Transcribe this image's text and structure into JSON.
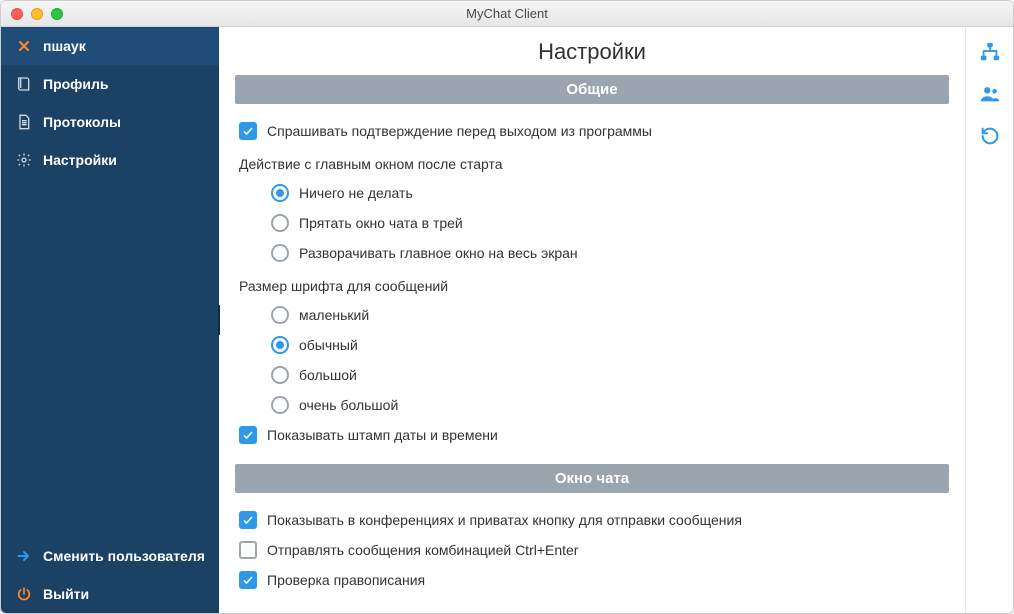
{
  "window": {
    "title": "MyChat Client"
  },
  "sidebar": {
    "items": [
      {
        "label": "пшаук"
      },
      {
        "label": "Профиль"
      },
      {
        "label": "Протоколы"
      },
      {
        "label": "Настройки"
      }
    ],
    "switch_user": "Сменить пользователя",
    "exit": "Выйти"
  },
  "content": {
    "title": "Настройки",
    "sections": [
      {
        "header": "Общие",
        "items": [
          {
            "type": "check",
            "checked": true,
            "label": "Спрашивать подтверждение перед выходом из программы"
          },
          {
            "type": "group",
            "label": "Действие с главным окном после старта",
            "options": [
              {
                "label": "Ничего не делать",
                "selected": true
              },
              {
                "label": "Прятать окно чата в трей",
                "selected": false
              },
              {
                "label": "Разворачивать главное окно на весь экран",
                "selected": false
              }
            ]
          },
          {
            "type": "group",
            "label": "Размер шрифта для сообщений",
            "options": [
              {
                "label": "маленький",
                "selected": false
              },
              {
                "label": "обычный",
                "selected": true
              },
              {
                "label": "большой",
                "selected": false
              },
              {
                "label": "очень большой",
                "selected": false
              }
            ]
          },
          {
            "type": "check",
            "checked": true,
            "label": "Показывать штамп даты и времени"
          }
        ]
      },
      {
        "header": "Окно чата",
        "items": [
          {
            "type": "check",
            "checked": true,
            "label": "Показывать в конференциях и приватах кнопку для отправки сообщения"
          },
          {
            "type": "check",
            "checked": false,
            "label": "Отправлять сообщения комбинацией Ctrl+Enter"
          },
          {
            "type": "check",
            "checked": true,
            "label": "Проверка правописания"
          }
        ]
      }
    ]
  }
}
